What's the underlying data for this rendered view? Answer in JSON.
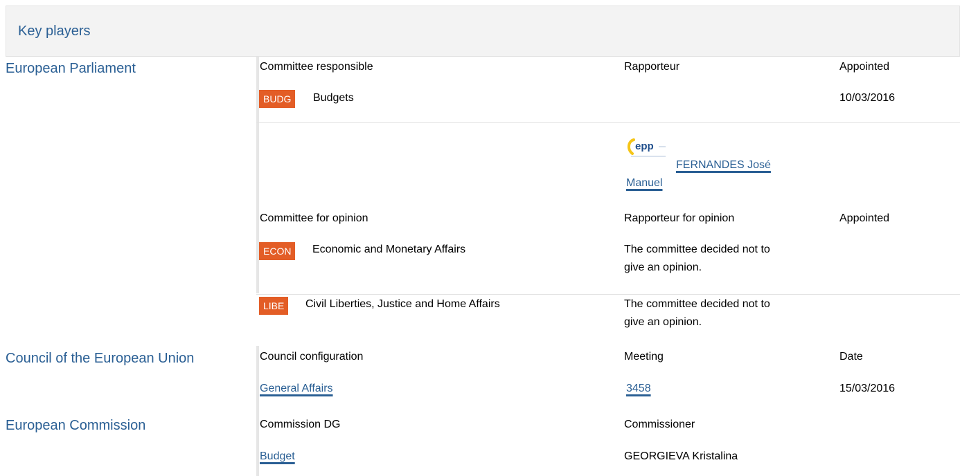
{
  "header": {
    "title": "Key players"
  },
  "parliament": {
    "label": "European Parliament",
    "col_committee": "Committee responsible",
    "col_rapporteur": "Rapporteur",
    "col_appointed": "Appointed",
    "responsible": {
      "code": "BUDG",
      "name": "Budgets",
      "date": "10/03/2016"
    },
    "rapporteur": {
      "party_logo": "epp",
      "name": "FERNANDES José Manuel"
    },
    "opinion_col_committee": "Committee for opinion",
    "opinion_col_rapporteur": "Rapporteur for opinion",
    "opinion_col_appointed": "Appointed",
    "opinions": [
      {
        "code": "ECON",
        "name": "Economic and Monetary Affairs",
        "note_line1": "The committee decided not to",
        "note_line2": "give an opinion."
      },
      {
        "code": "LIBE",
        "name": "Civil Liberties, Justice and Home Affairs",
        "note_line1": "The committee decided not to",
        "note_line2": "give an opinion."
      }
    ]
  },
  "council": {
    "label": "Council of the European Union",
    "col_config": "Council configuration",
    "col_meeting": "Meeting",
    "col_date": "Date",
    "config": "General Affairs",
    "meeting": "3458",
    "date": "15/03/2016"
  },
  "commission": {
    "label": "European Commission",
    "col_dg": "Commission DG",
    "col_commissioner": "Commissioner",
    "dg": "Budget",
    "commissioner": "GEORGIEVA Kristalina"
  },
  "colors": {
    "link": "#2a5f94",
    "badge": "#e35d26",
    "header_bg": "#f3f3f3"
  }
}
